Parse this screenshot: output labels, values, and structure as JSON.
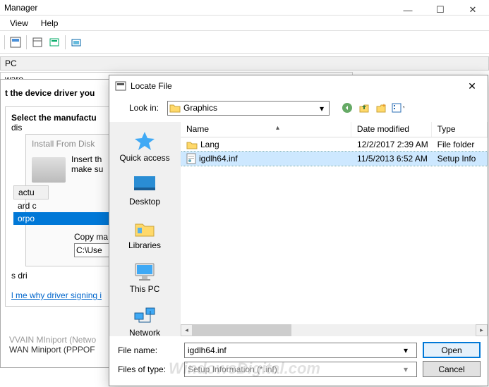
{
  "parent_window": {
    "title_fragment": "Manager",
    "menu": {
      "view": "View",
      "help": "Help"
    },
    "pane1": "PC",
    "pane2": "ware",
    "win_controls": {
      "min": "—",
      "max": "☐",
      "close": "✕"
    }
  },
  "wizard": {
    "heading": "t the device driver you",
    "select_label": "Select the manufactu",
    "disk_label": "dis",
    "install_title": "Install From Disk",
    "insert_text1": "Insert th",
    "insert_text2": "make su",
    "manuf_col": "actu",
    "manuf_items": [
      "ard c",
      "orpo"
    ],
    "copy_label": "Copy ma",
    "copy_value": "C:\\Use",
    "sdrv": "s dri",
    "signing_link": "l me why driver signing i",
    "wan1": "WAN Miniport (PPPOF",
    "wan0": "VVAIN MIniport (Netwo"
  },
  "dialog": {
    "title": "Locate File",
    "lookin_label": "Look in:",
    "lookin_value": "Graphics",
    "cols": {
      "name": "Name",
      "date": "Date modified",
      "type": "Type"
    },
    "rows": [
      {
        "name": "Lang",
        "date": "12/2/2017 2:39 AM",
        "type": "File folder",
        "kind": "folder",
        "selected": false
      },
      {
        "name": "igdlh64.inf",
        "date": "11/5/2013 6:52 AM",
        "type": "Setup Info",
        "kind": "file",
        "selected": true
      }
    ],
    "places": [
      {
        "label": "Quick access"
      },
      {
        "label": "Desktop"
      },
      {
        "label": "Libraries"
      },
      {
        "label": "This PC"
      },
      {
        "label": "Network"
      }
    ],
    "filename_label": "File name:",
    "filename_value": "igdlh64.inf",
    "filetype_label": "Files of type:",
    "filetype_value": "Setup Information (*.inf)",
    "open_btn": "Open",
    "cancel_btn": "Cancel"
  },
  "watermark": "WindowsDigital.com"
}
